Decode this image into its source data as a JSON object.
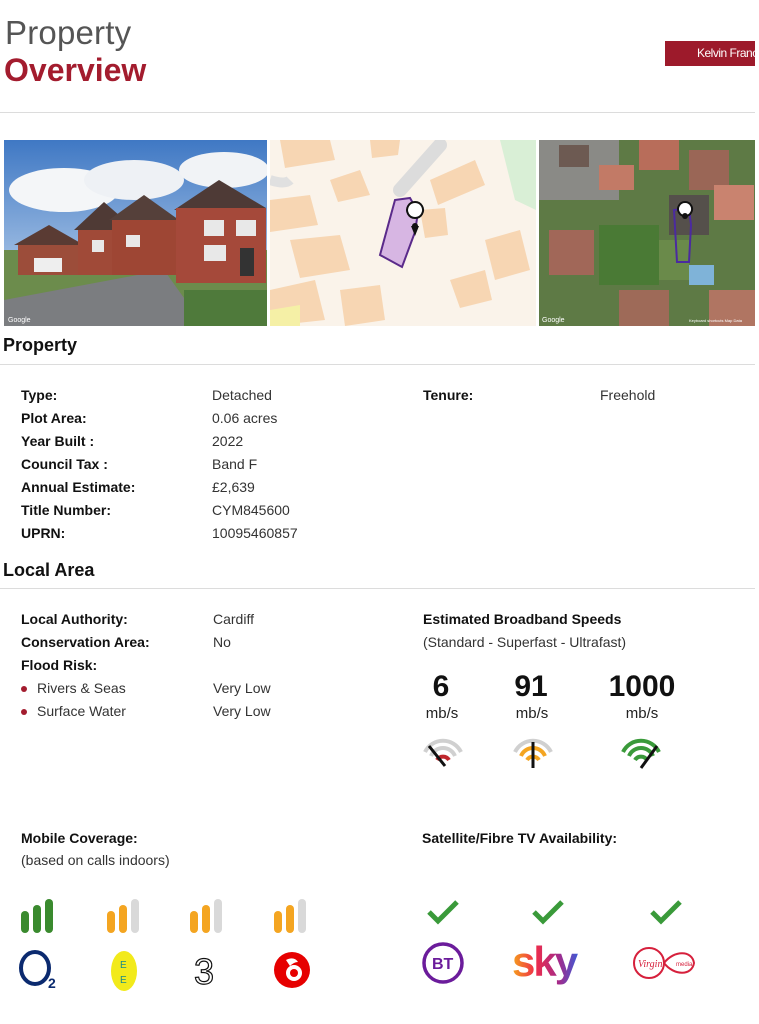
{
  "header": {
    "title_line1": "Property",
    "title_line2": "Overview",
    "brand_logo_text": "Kelvin Francis"
  },
  "images": {
    "street_view_credit": "Google",
    "map_credit": "",
    "satellite_credit": "Google",
    "satellite_attribution": "Keyboard shortcuts  Map Data"
  },
  "property": {
    "heading": "Property",
    "rows": [
      {
        "label": "Type:",
        "value": "Detached"
      },
      {
        "label": "Plot Area:",
        "value": "0.06 acres"
      },
      {
        "label": "Year Built :",
        "value": "2022"
      },
      {
        "label": "Council Tax :",
        "value": "Band F"
      },
      {
        "label": "Annual Estimate:",
        "value": "£2,639"
      },
      {
        "label": "Title Number:",
        "value": "CYM845600"
      },
      {
        "label": "UPRN:",
        "value": "10095460857"
      }
    ],
    "tenure_label": "Tenure:",
    "tenure_value": "Freehold"
  },
  "local_area": {
    "heading": "Local Area",
    "local_authority_label": "Local Authority:",
    "local_authority_value": "Cardiff",
    "conservation_label": "Conservation Area:",
    "conservation_value": "No",
    "flood_risk_label": "Flood Risk:",
    "flood_items": [
      {
        "label": "Rivers & Seas",
        "value": "Very Low"
      },
      {
        "label": "Surface Water",
        "value": "Very Low"
      }
    ]
  },
  "broadband": {
    "title": "Estimated Broadband Speeds",
    "subtitle": "(Standard - Superfast - Ultrafast)",
    "speeds": [
      {
        "value": "6",
        "unit": "mb/s",
        "icon": "speedometer-low-icon",
        "color": "#c0272d"
      },
      {
        "value": "91",
        "unit": "mb/s",
        "icon": "speedometer-mid-icon",
        "color": "#f4a521"
      },
      {
        "value": "1000",
        "unit": "mb/s",
        "icon": "speedometer-high-icon",
        "color": "#3a9a3a"
      }
    ]
  },
  "mobile": {
    "title": "Mobile Coverage:",
    "subtitle": "(based on calls indoors)",
    "networks": [
      {
        "name": "O2",
        "logo_text": "O2",
        "bars": 3,
        "bar_color": "#3a8a2e"
      },
      {
        "name": "EE",
        "logo_text": "E E",
        "bars": 2,
        "bar_color": "#f4a521"
      },
      {
        "name": "Three",
        "logo_text": "3",
        "bars": 2,
        "bar_color": "#f4a521"
      },
      {
        "name": "Vodafone",
        "logo_text": "",
        "bars": 2,
        "bar_color": "#f4a521"
      }
    ]
  },
  "tv": {
    "title": "Satellite/Fibre TV Availability:",
    "providers": [
      {
        "name": "BT",
        "logo_text": "BT",
        "available": true
      },
      {
        "name": "Sky",
        "logo_text": "sky",
        "available": true
      },
      {
        "name": "Virgin Media",
        "logo_text": "Virgin media",
        "available": true
      }
    ]
  },
  "colors": {
    "accent": "#a31c2e",
    "check": "#3a9a3a",
    "bar_inactive": "#d9d9d9"
  }
}
